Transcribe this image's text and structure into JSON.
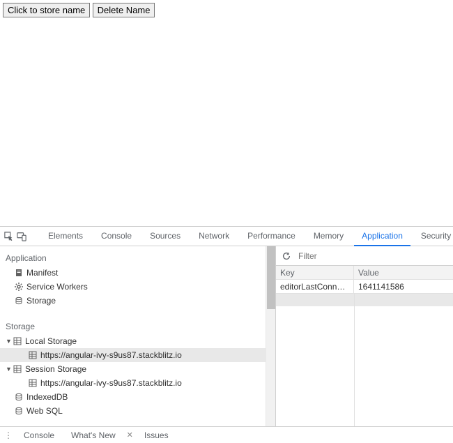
{
  "page": {
    "store_button": "Click to store name",
    "delete_button": "Delete Name"
  },
  "devtools": {
    "tabs": [
      "Elements",
      "Console",
      "Sources",
      "Network",
      "Performance",
      "Memory",
      "Application",
      "Security"
    ],
    "active_tab": "Application",
    "sidebar": {
      "section1_title": "Application",
      "app_items": [
        {
          "label": "Manifest",
          "icon": "manifest"
        },
        {
          "label": "Service Workers",
          "icon": "gear"
        },
        {
          "label": "Storage",
          "icon": "db"
        }
      ],
      "section2_title": "Storage",
      "storage_tree": {
        "local_storage": {
          "label": "Local Storage",
          "origin": "https://angular-ivy-s9us87.stackblitz.io"
        },
        "session_storage": {
          "label": "Session Storage",
          "origin": "https://angular-ivy-s9us87.stackblitz.io"
        },
        "indexeddb": "IndexedDB",
        "websql": "Web SQL"
      }
    },
    "right": {
      "filter_placeholder": "Filter",
      "col_key": "Key",
      "col_value": "Value",
      "rows": [
        {
          "key": "editorLastConnec...",
          "value": "1641141586"
        }
      ]
    },
    "drawer": {
      "tabs": [
        "Console",
        "What's New",
        "Issues"
      ]
    }
  }
}
